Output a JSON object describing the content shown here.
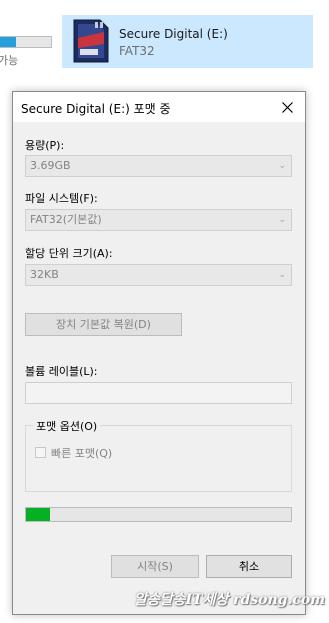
{
  "background": {
    "caption": "가능",
    "progress": 0.33,
    "drive": {
      "name": "Secure Digital (E:)",
      "filesystem": "FAT32",
      "icon": "sd-card-icon"
    }
  },
  "dialog": {
    "title": "Secure Digital (E:) 포맷 중",
    "capacity_label": "용량(P):",
    "capacity_value": "3.69GB",
    "filesystem_label": "파일 시스템(F):",
    "filesystem_value": "FAT32(기본값)",
    "allocation_label": "할당 단위 크기(A):",
    "allocation_value": "32KB",
    "restore_defaults": "장치 기본값 복원(D)",
    "volume_label_label": "볼륨 레이블(L):",
    "volume_label_value": "",
    "format_options_title": "포맷 옵션(O)",
    "quick_format_label": "빠른 포맷(Q)",
    "quick_format_checked": false,
    "progress": 0.09,
    "start_button": "시작(S)",
    "cancel_button": "취소"
  },
  "colors": {
    "progress_green": "#06b025",
    "selection_blue": "#cce8ff",
    "explorer_progress_blue": "#26a0da"
  },
  "watermark": "알송달송IT세상 rdsong.com"
}
